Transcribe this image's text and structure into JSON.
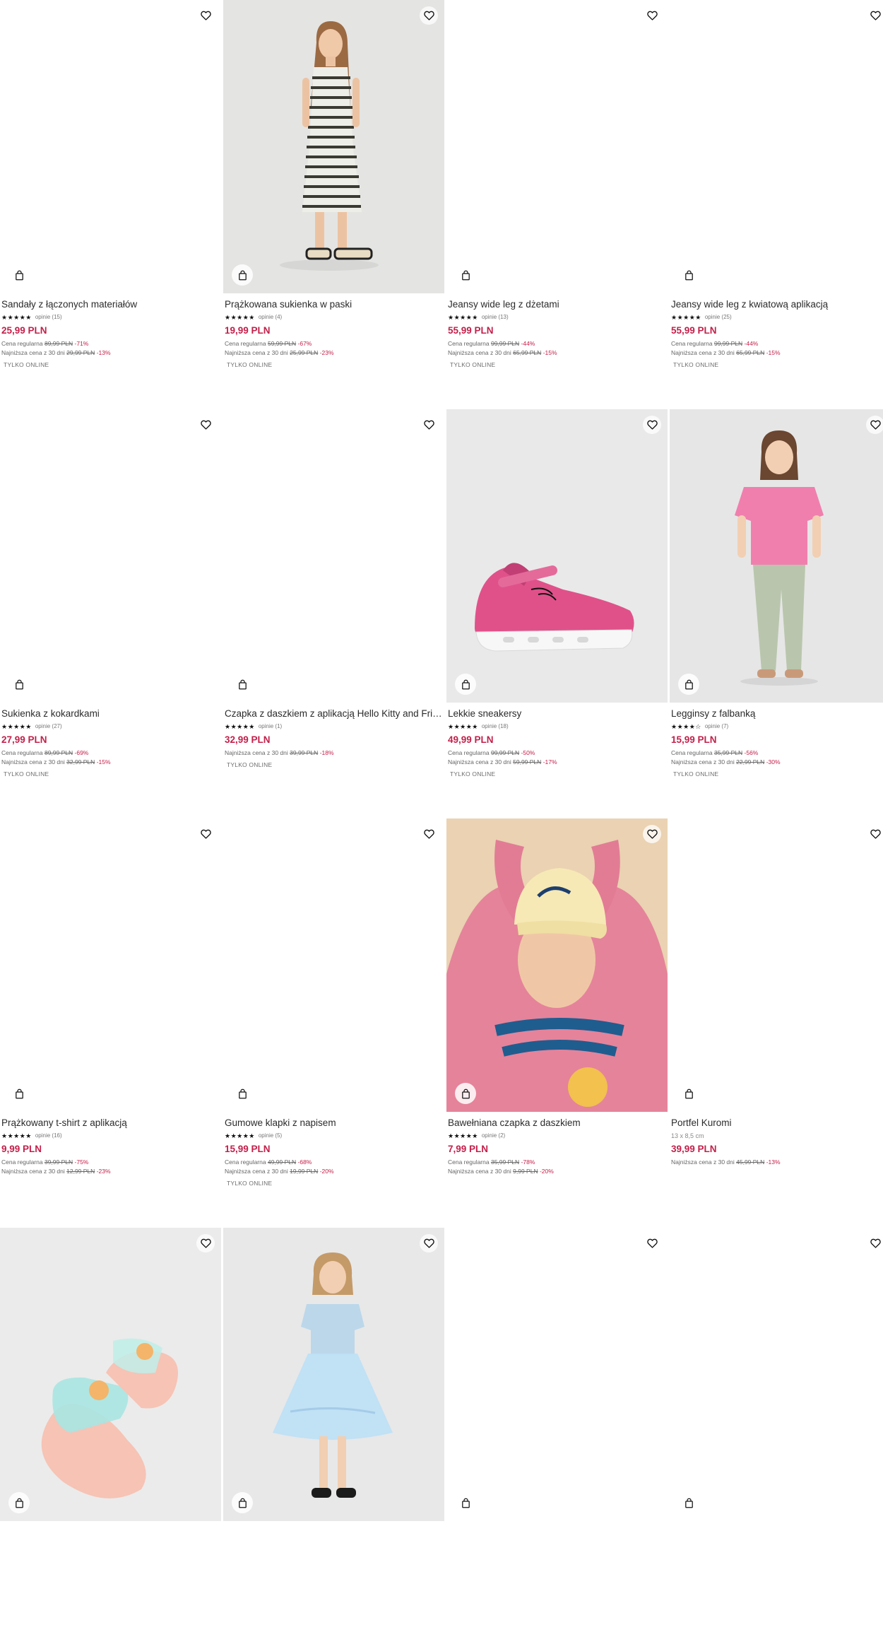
{
  "labels": {
    "regular_price": "Cena regularna",
    "lowest_30": "Najniższa cena z 30 dni",
    "online_only": "TYLKO ONLINE"
  },
  "products": [
    {
      "name": "Sandały z łączonych materiałów",
      "stars": "★★★★★",
      "reviews": "opinie (15)",
      "price": "25,99 PLN",
      "regular": "89,99 PLN",
      "regular_pct": "-71%",
      "lowest": "29,99 PLN",
      "lowest_pct": "-13%",
      "badge": "TYLKO ONLINE",
      "image": "blank"
    },
    {
      "name": "Prążkowana sukienka w paski",
      "stars": "★★★★★",
      "reviews": "opinie (4)",
      "price": "19,99 PLN",
      "regular": "59,99 PLN",
      "regular_pct": "-67%",
      "lowest": "25,99 PLN",
      "lowest_pct": "-23%",
      "badge": "TYLKO ONLINE",
      "image": "girl-striped-dress"
    },
    {
      "name": "Jeansy wide leg z dżetami",
      "stars": "★★★★★",
      "reviews": "opinie (13)",
      "price": "55,99 PLN",
      "regular": "99,99 PLN",
      "regular_pct": "-44%",
      "lowest": "65,99 PLN",
      "lowest_pct": "-15%",
      "badge": "TYLKO ONLINE",
      "image": "blank"
    },
    {
      "name": "Jeansy wide leg z kwiatową aplikacją",
      "stars": "★★★★★",
      "reviews": "opinie (25)",
      "price": "55,99 PLN",
      "regular": "99,99 PLN",
      "regular_pct": "-44%",
      "lowest": "65,99 PLN",
      "lowest_pct": "-15%",
      "badge": "TYLKO ONLINE",
      "image": "blank"
    },
    {
      "name": "Sukienka z kokardkami",
      "stars": "★★★★★",
      "reviews": "opinie (27)",
      "price": "27,99 PLN",
      "regular": "89,99 PLN",
      "regular_pct": "-69%",
      "lowest": "32,99 PLN",
      "lowest_pct": "-15%",
      "badge": "TYLKO ONLINE",
      "image": "blank"
    },
    {
      "name": "Czapka z daszkiem z aplikacją Hello Kitty and Friends",
      "stars": "★★★★★",
      "reviews": "opinie (1)",
      "price": "32,99 PLN",
      "regular": null,
      "regular_pct": null,
      "lowest": "39,99 PLN",
      "lowest_pct": "-18%",
      "badge": "TYLKO ONLINE",
      "image": "blank"
    },
    {
      "name": "Lekkie sneakersy",
      "stars": "★★★★★",
      "reviews": "opinie (18)",
      "price": "49,99 PLN",
      "regular": "99,99 PLN",
      "regular_pct": "-50%",
      "lowest": "59,99 PLN",
      "lowest_pct": "-17%",
      "badge": "TYLKO ONLINE",
      "image": "pink-sneaker"
    },
    {
      "name": "Legginsy z falbanką",
      "stars": "★★★★☆",
      "reviews": "opinie (7)",
      "price": "15,99 PLN",
      "regular": "35,99 PLN",
      "regular_pct": "-56%",
      "lowest": "22,99 PLN",
      "lowest_pct": "-30%",
      "badge": "TYLKO ONLINE",
      "image": "girl-pink-tshirt"
    },
    {
      "name": "Prążkowany t-shirt z aplikacją",
      "stars": "★★★★★",
      "reviews": "opinie (16)",
      "price": "9,99 PLN",
      "regular": "39,99 PLN",
      "regular_pct": "-75%",
      "lowest": "12,99 PLN",
      "lowest_pct": "-23%",
      "badge": null,
      "image": "blank"
    },
    {
      "name": "Gumowe klapki z napisem",
      "stars": "★★★★★",
      "reviews": "opinie (5)",
      "price": "15,99 PLN",
      "regular": "49,99 PLN",
      "regular_pct": "-68%",
      "lowest": "19,99 PLN",
      "lowest_pct": "-20%",
      "badge": "TYLKO ONLINE",
      "image": "blank"
    },
    {
      "name": "Bawełniana czapka z daszkiem",
      "stars": "★★★★★",
      "reviews": "opinie (2)",
      "price": "7,99 PLN",
      "regular": "35,99 PLN",
      "regular_pct": "-78%",
      "lowest": "9,99 PLN",
      "lowest_pct": "-20%",
      "badge": null,
      "image": "girl-cap"
    },
    {
      "name": "Portfel Kuromi",
      "size": "13 x 8,5 cm",
      "price": "39,99 PLN",
      "regular": null,
      "regular_pct": null,
      "lowest": "45,99 PLN",
      "lowest_pct": "-13%",
      "badge": null,
      "image": "blank"
    },
    {
      "name": "",
      "image": "slides"
    },
    {
      "name": "",
      "image": "girl-tutu"
    },
    {
      "name": "",
      "image": "blank"
    },
    {
      "name": "",
      "image": "blank"
    }
  ]
}
